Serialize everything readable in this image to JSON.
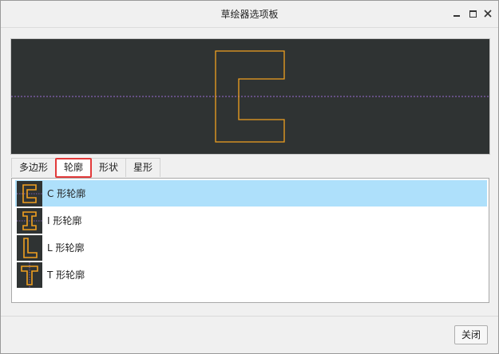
{
  "window": {
    "title": "草绘器选项板",
    "controls": [
      "minimize-icon",
      "maximize-icon",
      "close-icon"
    ]
  },
  "colors": {
    "preview_bg": "#2f3333",
    "shape_stroke": "#f0a020",
    "centerline": "#9b6bd6",
    "selected_row": "#aee0fb",
    "active_tab_border": "#e23a3a"
  },
  "tabs": [
    {
      "label": "多边形",
      "active": false
    },
    {
      "label": "轮廓",
      "active": true
    },
    {
      "label": "形状",
      "active": false
    },
    {
      "label": "星形",
      "active": false
    }
  ],
  "profiles": [
    {
      "label": "C 形轮廓",
      "icon": "c-profile-icon",
      "selected": true
    },
    {
      "label": "I 形轮廓",
      "icon": "i-profile-icon",
      "selected": false
    },
    {
      "label": "L 形轮廓",
      "icon": "l-profile-icon",
      "selected": false
    },
    {
      "label": "T 形轮廓",
      "icon": "t-profile-icon",
      "selected": false
    }
  ],
  "footer": {
    "close_label": "关闭"
  }
}
